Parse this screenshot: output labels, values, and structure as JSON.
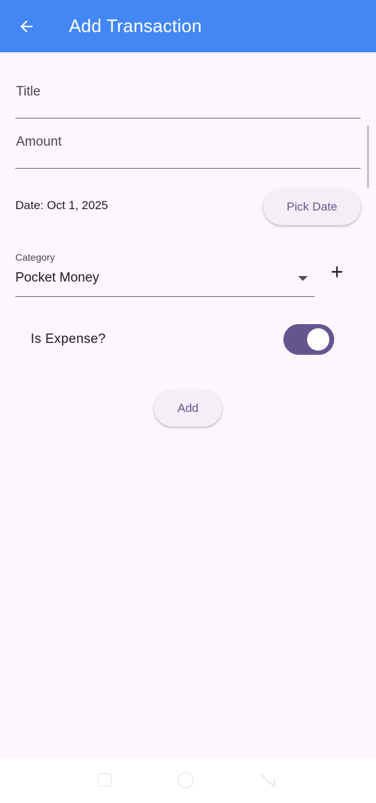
{
  "appbar": {
    "title": "Add Transaction",
    "back_icon": "arrow-left-icon",
    "color": "#4387f5"
  },
  "form": {
    "title_field": {
      "label": "Title",
      "value": ""
    },
    "amount_field": {
      "label": "Amount",
      "value": ""
    },
    "date_text": "Date: Oct 1, 2025",
    "pick_date_label": "Pick Date",
    "category": {
      "label": "Category",
      "selected": "Pocket Money",
      "dropdown_icon": "caret-down-icon",
      "add_icon": "plus-icon"
    },
    "is_expense": {
      "label": "Is Expense?",
      "on": true
    },
    "add_label": "Add"
  },
  "colors": {
    "background": "#fdf7fd",
    "accent": "#65558f",
    "button_bg": "#f6eef7"
  },
  "navbar": {
    "icons": [
      "square-icon",
      "circle-icon",
      "back-triangle-icon"
    ]
  }
}
